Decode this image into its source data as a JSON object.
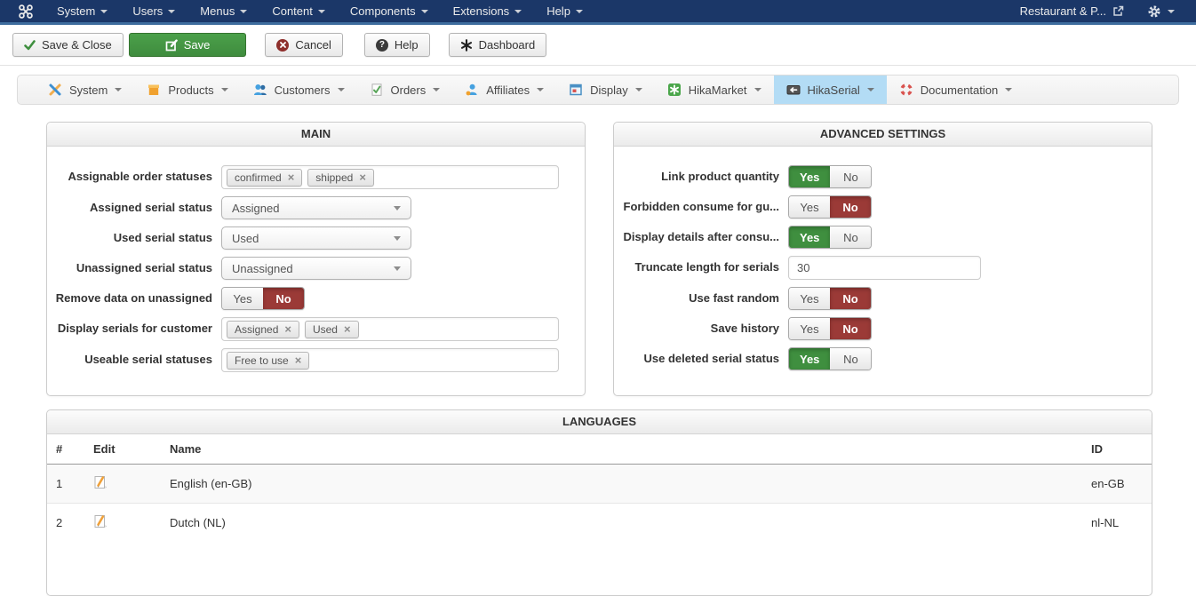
{
  "navbar": {
    "menu": [
      {
        "label": "System"
      },
      {
        "label": "Users"
      },
      {
        "label": "Menus"
      },
      {
        "label": "Content"
      },
      {
        "label": "Components"
      },
      {
        "label": "Extensions"
      },
      {
        "label": "Help"
      }
    ],
    "site_name": "Restaurant & P..."
  },
  "toolbar": {
    "buttons": [
      {
        "label": "Save & Close",
        "icon": "check-icon"
      },
      {
        "label": "Save",
        "icon": "save-icon",
        "variant": "success"
      },
      {
        "label": "Cancel",
        "icon": "cancel-icon"
      },
      {
        "label": "Help",
        "icon": "help-icon",
        "glyph": "?"
      },
      {
        "label": "Dashboard",
        "icon": "dashboard-icon"
      }
    ]
  },
  "tabs": [
    {
      "label": "System",
      "icon": "tools-icon"
    },
    {
      "label": "Products",
      "icon": "box-icon"
    },
    {
      "label": "Customers",
      "icon": "users-icon"
    },
    {
      "label": "Orders",
      "icon": "order-check-icon"
    },
    {
      "label": "Affiliates",
      "icon": "affiliate-user-icon"
    },
    {
      "label": "Display",
      "icon": "display-icon"
    },
    {
      "label": "HikaMarket",
      "icon": "hikamarket-icon"
    },
    {
      "label": "HikaSerial",
      "icon": "hikaserial-icon",
      "active": true
    },
    {
      "label": "Documentation",
      "icon": "lifebuoy-icon"
    }
  ],
  "main_panel": {
    "title": "MAIN",
    "fields": [
      {
        "label": "Assignable order statuses",
        "type": "tags",
        "values": [
          "confirmed",
          "shipped"
        ]
      },
      {
        "label": "Assigned serial status",
        "type": "select",
        "value": "Assigned"
      },
      {
        "label": "Used serial status",
        "type": "select",
        "value": "Used"
      },
      {
        "label": "Unassigned serial status",
        "type": "select",
        "value": "Unassigned"
      },
      {
        "label": "Remove data on unassigned",
        "type": "toggle",
        "value": "No"
      },
      {
        "label": "Display serials for customer",
        "type": "tags",
        "values": [
          "Assigned",
          "Used"
        ]
      },
      {
        "label": "Useable serial statuses",
        "type": "tags",
        "values": [
          "Free to use"
        ]
      }
    ]
  },
  "advanced_panel": {
    "title": "ADVANCED SETTINGS",
    "fields": [
      {
        "label": "Link product quantity",
        "type": "toggle",
        "value": "Yes"
      },
      {
        "label": "Forbidden consume for gu...",
        "type": "toggle",
        "value": "No"
      },
      {
        "label": "Display details after consu...",
        "type": "toggle",
        "value": "Yes"
      },
      {
        "label": "Truncate length for serials",
        "type": "text",
        "value": "30"
      },
      {
        "label": "Use fast random",
        "type": "toggle",
        "value": "No"
      },
      {
        "label": "Save history",
        "type": "toggle",
        "value": "No"
      },
      {
        "label": "Use deleted serial status",
        "type": "toggle",
        "value": "Yes"
      }
    ]
  },
  "toggle_labels": {
    "yes": "Yes",
    "no": "No"
  },
  "remove_tag_symbol": "×",
  "languages_panel": {
    "title": "LANGUAGES",
    "columns": {
      "num": "#",
      "edit": "Edit",
      "name": "Name",
      "id": "ID"
    },
    "rows": [
      {
        "num": "1",
        "name": "English (en-GB)",
        "id": "en-GB"
      },
      {
        "num": "2",
        "name": "Dutch (NL)",
        "id": "nl-NL"
      }
    ]
  },
  "colors": {
    "navbar": "#1b3768",
    "navbar_strip": "#3e6d9e",
    "active_tab": "#b3dcf5",
    "save_button_green": "#46953f",
    "toggle_green": "#3f8f3f",
    "toggle_red": "#9b3a37"
  }
}
